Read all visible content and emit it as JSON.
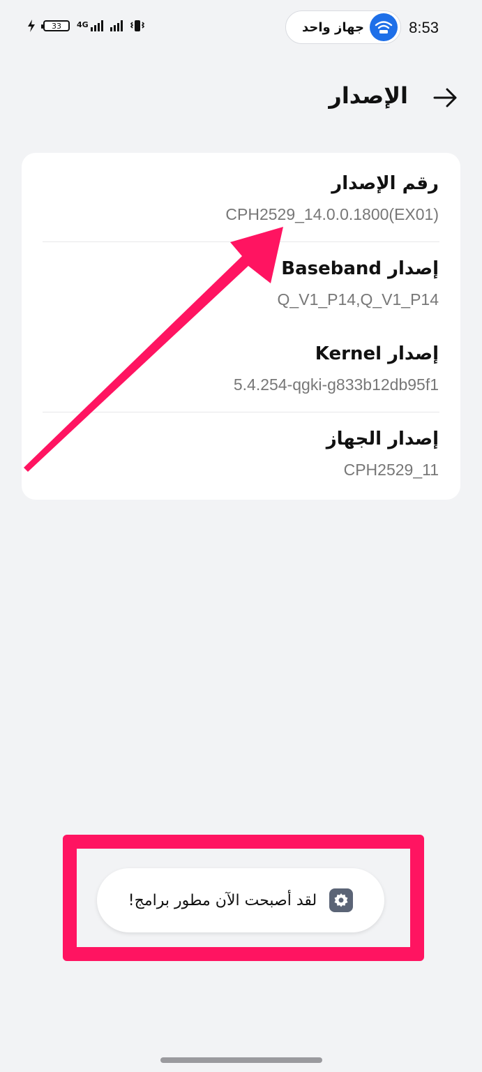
{
  "status_bar": {
    "time": "8:53",
    "hotspot_label": "جهاز واحد",
    "battery_level": "33",
    "network": "4G",
    "icons": [
      "charging-icon",
      "battery-icon",
      "signal-4g-icon",
      "signal-icon",
      "vibrate-icon",
      "wifi-hotspot-icon"
    ]
  },
  "header": {
    "title": "الإصدار",
    "back_icon": "arrow-icon"
  },
  "version_items": [
    {
      "title": "رقم الإصدار",
      "value": "CPH2529_14.0.0.1800(EX01)"
    },
    {
      "title": "إصدار Baseband",
      "value": "Q_V1_P14,Q_V1_P14"
    },
    {
      "title": "إصدار Kernel",
      "value": "5.4.254-qgki-g833b12db95f1"
    },
    {
      "title": "إصدار الجهاز",
      "value": "CPH2529_11"
    }
  ],
  "toast": {
    "message": "لقد أصبحت الآن مطور برامج!",
    "icon": "settings-gear-icon"
  },
  "colors": {
    "background": "#F2F3F5",
    "card": "#FFFFFF",
    "annotation": "#FF1461",
    "hotspot_blue": "#1E6FE8",
    "secondary_text": "#777777"
  }
}
